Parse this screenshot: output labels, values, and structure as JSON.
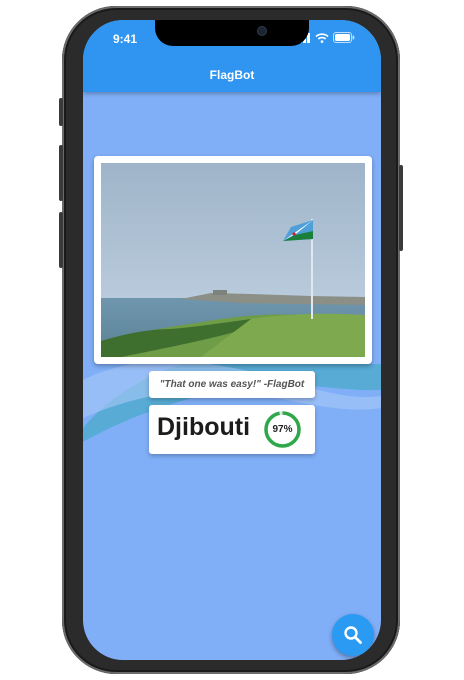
{
  "status": {
    "time": "9:41"
  },
  "appbar": {
    "title": "FlagBot"
  },
  "quote": {
    "text": "\"That one was easy!\" -FlagBot"
  },
  "result": {
    "country": "Djibouti",
    "confidence_label": "97%",
    "confidence": 0.97
  },
  "photo": {
    "subject": "flag of Djibouti on a pole by the sea"
  },
  "colors": {
    "appbar": "#2f95f0",
    "background": "#80aff8",
    "fab": "#2b9af3",
    "ring": "#2ea84a",
    "wave": "#4aa9c9"
  },
  "icons": {
    "fab": "search-icon"
  }
}
